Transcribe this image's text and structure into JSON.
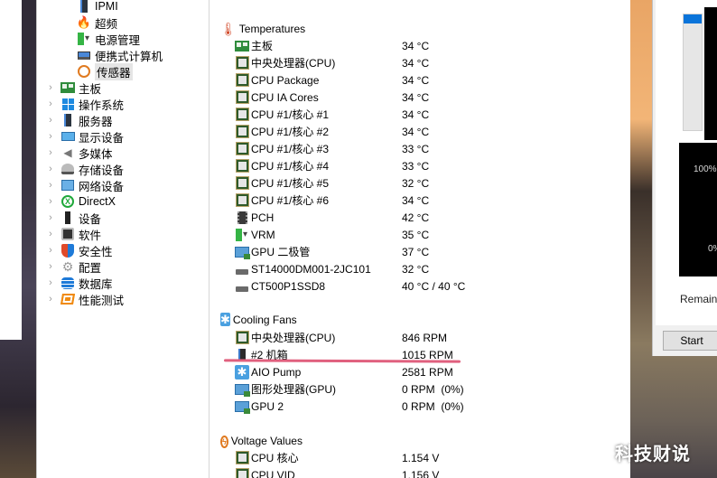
{
  "tree": {
    "items": [
      {
        "label": "IPMI",
        "icon": "server-icon",
        "indent": 2,
        "expandable": false
      },
      {
        "label": "超频",
        "icon": "flame-icon",
        "indent": 2,
        "expandable": false
      },
      {
        "label": "电源管理",
        "icon": "battery-plug-icon",
        "indent": 2,
        "expandable": false
      },
      {
        "label": "便携式计算机",
        "icon": "laptop-icon",
        "indent": 2,
        "expandable": false
      },
      {
        "label": "传感器",
        "icon": "gauge-icon",
        "indent": 2,
        "expandable": false,
        "selected": true
      },
      {
        "label": "主板",
        "icon": "motherboard-icon",
        "indent": 1,
        "expandable": true
      },
      {
        "label": "操作系统",
        "icon": "windows-icon",
        "indent": 1,
        "expandable": true
      },
      {
        "label": "服务器",
        "icon": "server-icon",
        "indent": 1,
        "expandable": true
      },
      {
        "label": "显示设备",
        "icon": "monitor-icon",
        "indent": 1,
        "expandable": true
      },
      {
        "label": "多媒体",
        "icon": "speaker-icon",
        "indent": 1,
        "expandable": true
      },
      {
        "label": "存储设备",
        "icon": "storage-icon",
        "indent": 1,
        "expandable": true
      },
      {
        "label": "网络设备",
        "icon": "network-icon",
        "indent": 1,
        "expandable": true
      },
      {
        "label": "DirectX",
        "icon": "xbox-icon",
        "indent": 1,
        "expandable": true
      },
      {
        "label": "设备",
        "icon": "device-icon",
        "indent": 1,
        "expandable": true
      },
      {
        "label": "软件",
        "icon": "software-icon",
        "indent": 1,
        "expandable": true
      },
      {
        "label": "安全性",
        "icon": "shield-icon",
        "indent": 1,
        "expandable": true
      },
      {
        "label": "配置",
        "icon": "config-gear-icon",
        "indent": 1,
        "expandable": true
      },
      {
        "label": "数据库",
        "icon": "database-icon",
        "indent": 1,
        "expandable": true
      },
      {
        "label": "性能测试",
        "icon": "benchmark-icon",
        "indent": 1,
        "expandable": true
      }
    ]
  },
  "sensors": {
    "temperatures": {
      "title": "Temperatures",
      "icon": "thermometer-icon",
      "rows": [
        {
          "name": "主板",
          "value": "34 °C",
          "icon": "motherboard-icon"
        },
        {
          "name": "中央处理器(CPU)",
          "value": "34 °C",
          "icon": "cpu-chip-icon"
        },
        {
          "name": "CPU Package",
          "value": "34 °C",
          "icon": "cpu-chip-icon"
        },
        {
          "name": "CPU IA Cores",
          "value": "34 °C",
          "icon": "cpu-chip-icon"
        },
        {
          "name": "CPU #1/核心 #1",
          "value": "34 °C",
          "icon": "cpu-chip-icon"
        },
        {
          "name": "CPU #1/核心 #2",
          "value": "34 °C",
          "icon": "cpu-chip-icon"
        },
        {
          "name": "CPU #1/核心 #3",
          "value": "33 °C",
          "icon": "cpu-chip-icon"
        },
        {
          "name": "CPU #1/核心 #4",
          "value": "33 °C",
          "icon": "cpu-chip-icon"
        },
        {
          "name": "CPU #1/核心 #5",
          "value": "32 °C",
          "icon": "cpu-chip-icon"
        },
        {
          "name": "CPU #1/核心 #6",
          "value": "34 °C",
          "icon": "cpu-chip-icon"
        },
        {
          "name": "PCH",
          "value": "42 °C",
          "icon": "pch-chip-icon"
        },
        {
          "name": "VRM",
          "value": "35 °C",
          "icon": "battery-plug-icon"
        },
        {
          "name": "GPU 二极管",
          "value": "37 °C",
          "icon": "gpu-icon"
        },
        {
          "name": "ST14000DM001-2JC101",
          "value": "32 °C",
          "icon": "hdd-icon"
        },
        {
          "name": "CT500P1SSD8",
          "value": "40 °C / 40 °C",
          "icon": "hdd-icon"
        }
      ]
    },
    "fans": {
      "title": "Cooling Fans",
      "icon": "fan-icon",
      "rows": [
        {
          "name": "中央处理器(CPU)",
          "value": "846 RPM",
          "icon": "cpu-chip-icon"
        },
        {
          "name": "#2 机箱",
          "value": "1015 RPM",
          "icon": "case-icon"
        },
        {
          "name": "AIO Pump",
          "value": "2581 RPM",
          "icon": "fan-icon"
        },
        {
          "name": "图形处理器(GPU)",
          "value": "0 RPM  (0%)",
          "icon": "gpu-icon"
        },
        {
          "name": "GPU 2",
          "value": "0 RPM  (0%)",
          "icon": "gpu-icon"
        }
      ]
    },
    "voltages": {
      "title": "Voltage Values",
      "icon": "voltage-icon",
      "rows": [
        {
          "name": "CPU 核心",
          "value": "1.154 V",
          "icon": "cpu-chip-icon"
        },
        {
          "name": "CPU VID",
          "value": "1.156 V",
          "icon": "cpu-chip-icon"
        }
      ]
    }
  },
  "side_panel": {
    "progress_fraction": 0.06,
    "graph_top_label": "100%",
    "graph_bottom_label": "0%",
    "remaining_label": "Remainin",
    "start_label": "Start"
  },
  "watermark": "科技财说",
  "colors": {
    "accent_blue": "#0a74da",
    "highlight_underline": "#e0607e"
  }
}
